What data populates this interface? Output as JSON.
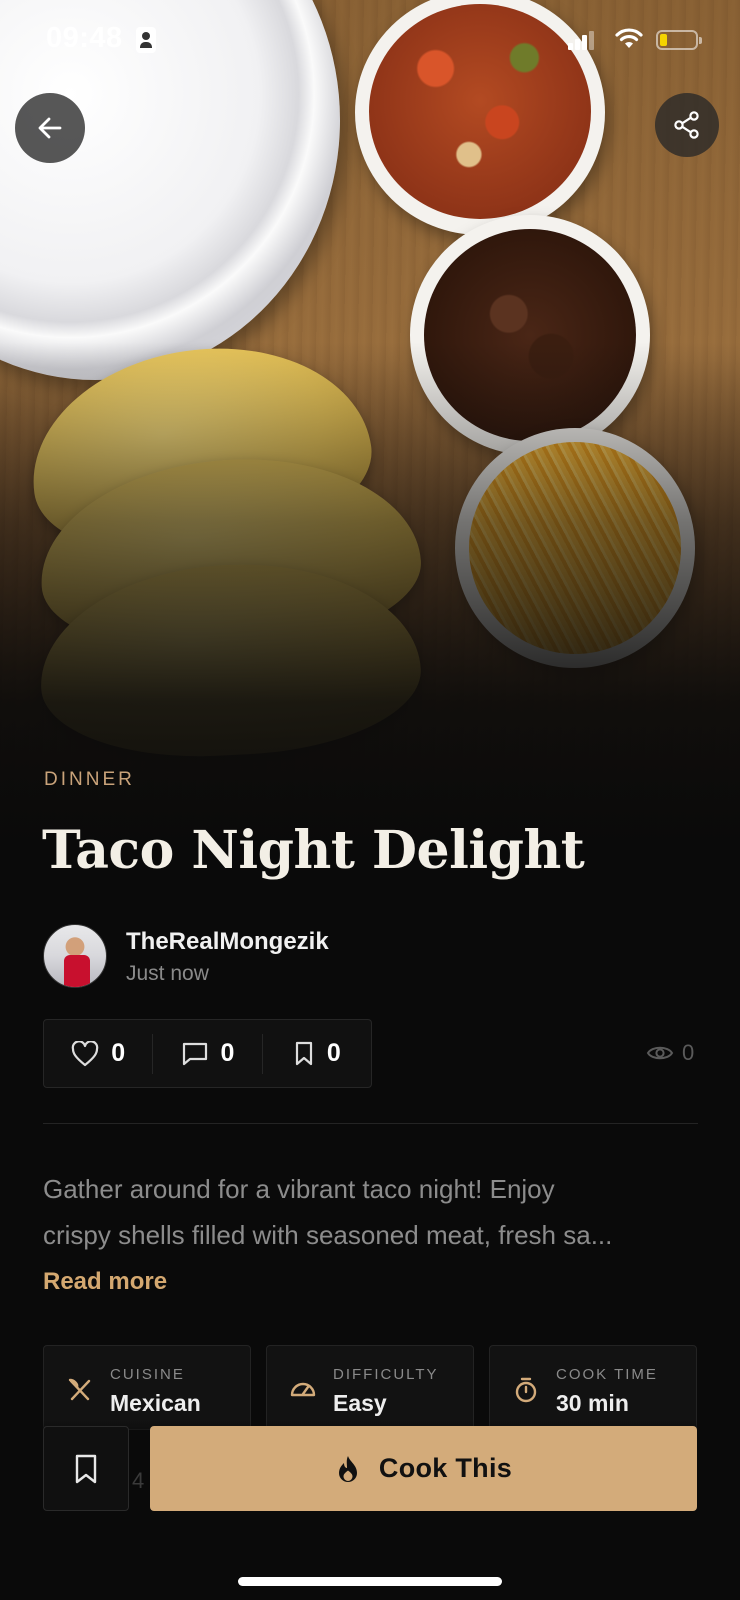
{
  "status_bar": {
    "time": "09:48",
    "battery_level": 0.2,
    "battery_color": "#f5d400"
  },
  "nav": {
    "back_icon": "arrow-left-icon",
    "share_icon": "share-icon"
  },
  "recipe": {
    "category": "DINNER",
    "title": "Taco Night Delight",
    "author": {
      "name": "TheRealMongezik",
      "posted": "Just now"
    },
    "stats": {
      "likes": "0",
      "comments": "0",
      "saves": "0",
      "views": "0"
    },
    "description_lines": [
      "Gather around for a vibrant taco night! Enjoy",
      "crispy shells filled with seasoned meat, fresh sa..."
    ],
    "read_more": "Read more",
    "info": [
      {
        "label": "CUISINE",
        "value": "Mexican",
        "icon": "utensils-icon"
      },
      {
        "label": "DIFFICULTY",
        "value": "Easy",
        "icon": "gauge-icon"
      },
      {
        "label": "COOK TIME",
        "value": "30 min",
        "icon": "stopwatch-icon"
      }
    ]
  },
  "actions": {
    "save_icon": "bookmark-icon",
    "cook_label": "Cook This",
    "cook_icon": "flame-icon",
    "peek_text": "4"
  },
  "colors": {
    "accent": "#d3ab7a",
    "category": "#c9a37a",
    "background": "#0a0a0a"
  }
}
